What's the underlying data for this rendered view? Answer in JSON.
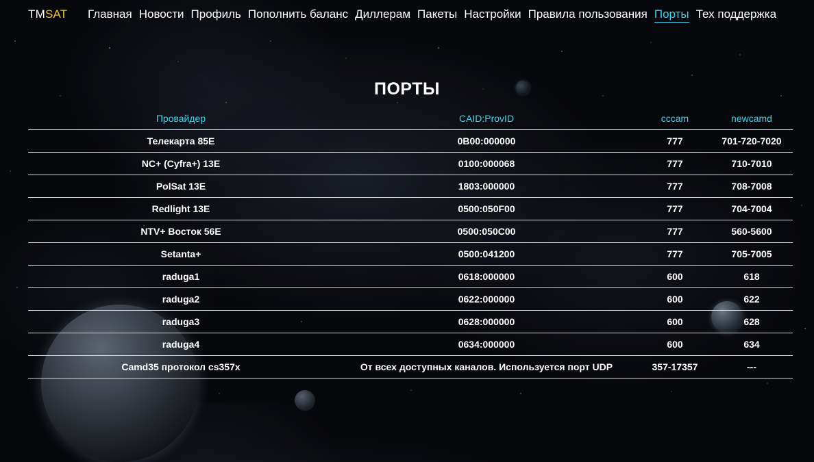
{
  "logo": {
    "part1": "TM",
    "part2": "SAT"
  },
  "nav": [
    {
      "label": "Главная",
      "active": false
    },
    {
      "label": "Новости",
      "active": false
    },
    {
      "label": "Профиль",
      "active": false
    },
    {
      "label": "Пополнить баланс",
      "active": false
    },
    {
      "label": "Диллерам",
      "active": false
    },
    {
      "label": "Пакеты",
      "active": false
    },
    {
      "label": "Настройки",
      "active": false
    },
    {
      "label": "Правила пользования",
      "active": false
    },
    {
      "label": "Порты",
      "active": true
    },
    {
      "label": "Тех поддержка",
      "active": false
    }
  ],
  "page": {
    "title": "ПОРТЫ"
  },
  "table": {
    "headers": {
      "provider": "Провайдер",
      "caid": "CAID:ProvID",
      "cccam": "cccam",
      "newcamd": "newcamd"
    },
    "rows": [
      {
        "provider": "Телекарта 85E",
        "caid": "0B00:000000",
        "cccam": "777",
        "newcamd": "701-720-7020"
      },
      {
        "provider": "NC+ (Cyfra+) 13E",
        "caid": "0100:000068",
        "cccam": "777",
        "newcamd": "710-7010"
      },
      {
        "provider": "PolSat 13E",
        "caid": "1803:000000",
        "cccam": "777",
        "newcamd": "708-7008"
      },
      {
        "provider": "Redlight 13E",
        "caid": "0500:050F00",
        "cccam": "777",
        "newcamd": "704-7004"
      },
      {
        "provider": "NTV+ Восток 56E",
        "caid": "0500:050C00",
        "cccam": "777",
        "newcamd": "560-5600"
      },
      {
        "provider": "Setanta+",
        "caid": "0500:041200",
        "cccam": "777",
        "newcamd": "705-7005"
      },
      {
        "provider": "raduga1",
        "caid": "0618:000000",
        "cccam": "600",
        "newcamd": "618"
      },
      {
        "provider": "raduga2",
        "caid": "0622:000000",
        "cccam": "600",
        "newcamd": "622"
      },
      {
        "provider": "raduga3",
        "caid": "0628:000000",
        "cccam": "600",
        "newcamd": "628"
      },
      {
        "provider": "raduga4",
        "caid": "0634:000000",
        "cccam": "600",
        "newcamd": "634"
      },
      {
        "provider": "Camd35 протокол cs357x",
        "caid": "От всех доступных каналов. Используется порт UDP",
        "cccam": "357-17357",
        "newcamd": "---"
      }
    ]
  },
  "colors": {
    "accent": "#3ad6f0",
    "logo_accent": "#f1c232",
    "background": "#07080c"
  }
}
